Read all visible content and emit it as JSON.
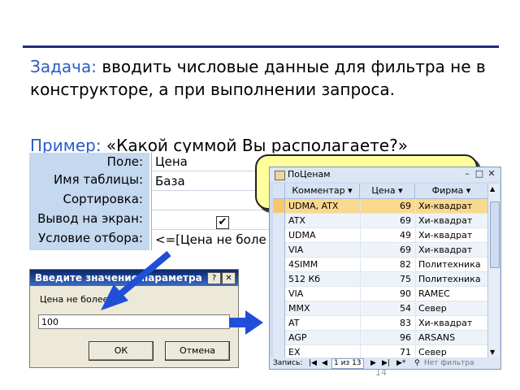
{
  "slide": {
    "task_label": "Задача:",
    "task_text": "вводить числовые данные для фильтра не в конструкторе, а при выполнении запроса.",
    "example_label": "Пример:",
    "example_text": "«Какой суммой Вы располагаете?»",
    "page_number": "14"
  },
  "design_grid": {
    "row_labels": [
      "Поле:",
      "Имя таблицы:",
      "Сортировка:",
      "Вывод на экран:",
      "Условие отбора:"
    ],
    "field": "Цена",
    "table": "База",
    "sort": "",
    "criteria": "<=[Цена не боле"
  },
  "datasheet": {
    "title": "ПоЦенам",
    "headers": [
      "Комментар",
      "Цена",
      "Фирма"
    ],
    "rows": [
      {
        "comment": "UDMA, ATX",
        "price": "69",
        "firm": "Хи-квадрат"
      },
      {
        "comment": "ATX",
        "price": "69",
        "firm": "Хи-квадрат"
      },
      {
        "comment": "UDMA",
        "price": "49",
        "firm": "Хи-квадрат"
      },
      {
        "comment": "VIA",
        "price": "69",
        "firm": "Хи-квадрат"
      },
      {
        "comment": "4SIMM",
        "price": "82",
        "firm": "Политехника"
      },
      {
        "comment": "512 Кб",
        "price": "75",
        "firm": "Политехника"
      },
      {
        "comment": "VIA",
        "price": "90",
        "firm": "RAMEC"
      },
      {
        "comment": "MMX",
        "price": "54",
        "firm": "Север"
      },
      {
        "comment": "AT",
        "price": "83",
        "firm": "Хи-квадрат"
      },
      {
        "comment": "AGP",
        "price": "96",
        "firm": "ARSANS"
      },
      {
        "comment": "EX",
        "price": "71",
        "firm": "Север"
      }
    ],
    "nav": {
      "label": "Запись:",
      "position": "1 из 13",
      "filter": "Нет фильтра"
    }
  },
  "dialog": {
    "title": "Введите значение параметра",
    "help": "?",
    "close": "✕",
    "prompt": "Цена не более",
    "value": "100",
    "ok": "ОК",
    "cancel": "Отмена"
  },
  "colors": {
    "title_rule": "#1f2f7a",
    "label_blue": "#2a5cc8",
    "arrow_blue": "#1f4fd8",
    "callout_fill": "#fffe9c"
  }
}
